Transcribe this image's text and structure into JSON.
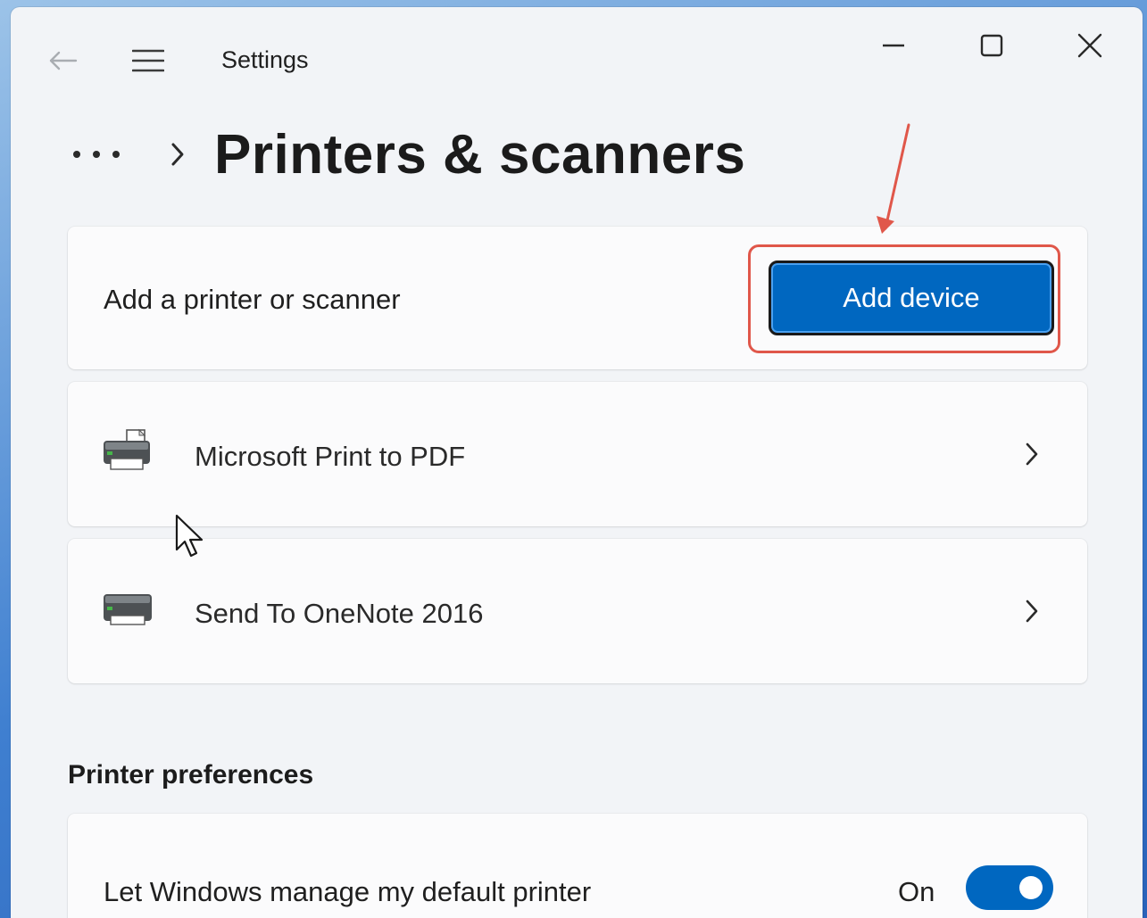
{
  "window": {
    "app_title": "Settings",
    "controls": {
      "minimize": "minimize-icon",
      "maximize": "maximize-icon",
      "close": "close-icon"
    }
  },
  "nav": {
    "back_icon": "back-arrow-icon",
    "menu_icon": "hamburger-menu-icon"
  },
  "breadcrumb": {
    "more_icon": "more-dots-icon",
    "separator_icon": "chevron-right-icon",
    "page_title": "Printers & scanners"
  },
  "add_card": {
    "label": "Add a printer or scanner",
    "button_label": "Add device"
  },
  "printers": [
    {
      "name": "Microsoft Print to PDF",
      "icon": "printer-icon"
    },
    {
      "name": "Send To OneNote 2016",
      "icon": "printer-icon"
    }
  ],
  "preferences": {
    "section_title": "Printer preferences",
    "default_printer": {
      "label": "Let Windows manage my default printer",
      "state_label": "On",
      "enabled": true
    }
  },
  "colors": {
    "accent": "#0067c0",
    "annotation": "#e0574a",
    "window_bg": "#f2f4f7",
    "card_bg": "#fbfbfc"
  }
}
